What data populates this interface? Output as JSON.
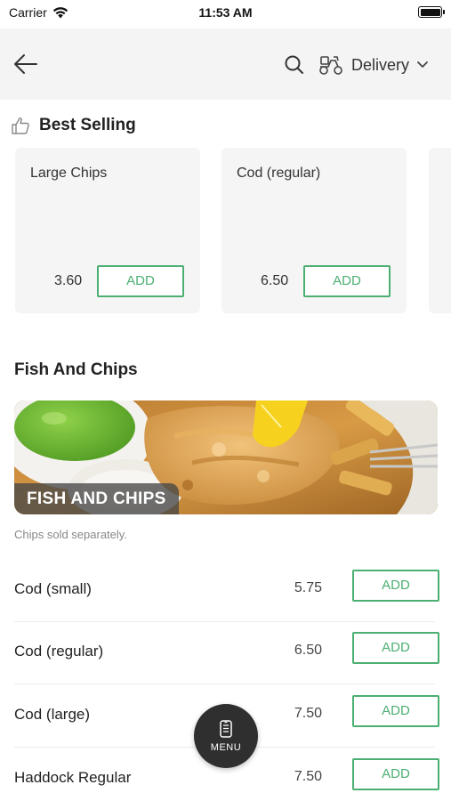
{
  "status_bar": {
    "carrier": "Carrier",
    "time": "11:53 AM"
  },
  "header": {
    "delivery_label": "Delivery"
  },
  "best_selling": {
    "title": "Best Selling",
    "items": [
      {
        "name": "Large Chips",
        "price": "3.60",
        "add_label": "ADD"
      },
      {
        "name": "Cod (regular)",
        "price": "6.50",
        "add_label": "ADD"
      }
    ]
  },
  "category": {
    "title": "Fish And Chips",
    "banner_label": "FISH AND CHIPS",
    "note": "Chips sold separately.",
    "items": [
      {
        "name": "Cod (small)",
        "price": "5.75",
        "add_label": "ADD"
      },
      {
        "name": "Cod (regular)",
        "price": "6.50",
        "add_label": "ADD"
      },
      {
        "name": "Cod (large)",
        "price": "7.50",
        "add_label": "ADD"
      },
      {
        "name": "Haddock Regular",
        "price": "7.50",
        "add_label": "ADD"
      }
    ]
  },
  "menu_button": {
    "label": "MENU"
  },
  "colors": {
    "accent": "#4caf72",
    "header_bg": "#f4f4f4",
    "card_bg": "#f5f5f5",
    "fab_bg": "#2f2f2f"
  },
  "icons": [
    "wifi-icon",
    "battery-icon",
    "back-arrow-icon",
    "search-icon",
    "scooter-icon",
    "chevron-down-icon",
    "thumbs-up-icon",
    "menu-phone-icon"
  ]
}
